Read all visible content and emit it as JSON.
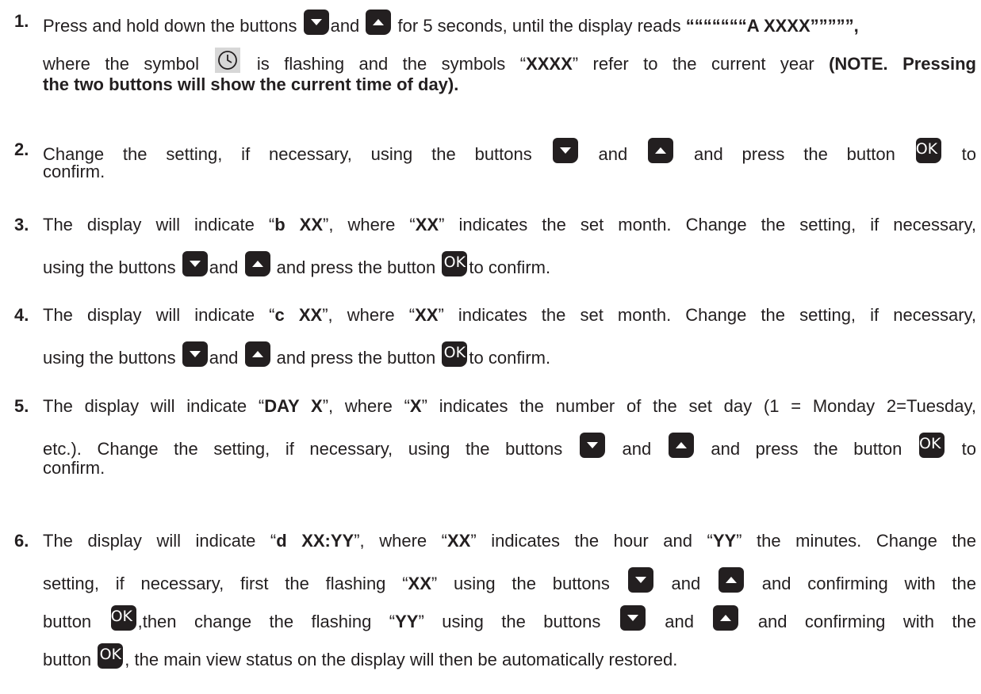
{
  "icons": {
    "down": "down-arrow-button-icon",
    "up": "up-arrow-button-icon",
    "ok": "ok-button-icon",
    "clock": "clock-icon",
    "ok_label": "OK"
  },
  "steps": [
    {
      "num": "1.",
      "l1a": "Press and hold down the buttons",
      "l1b": "and",
      "l1c": "for 5 seconds, until the display reads",
      "l1d": "“““““““A XXXX”””””,",
      "l2a": "where the symbol",
      "l2b": "is flashing and the symbols “",
      "l2c": "XXXX",
      "l2d": "” refer to the current year",
      "l2e": "(NOTE. Pressing",
      "l3": "the two buttons will show the current time of day)."
    },
    {
      "num": "2.",
      "l1a": "Change the setting, if necessary, using the buttons",
      "l1b": "and",
      "l1c": "and press the button",
      "l1d": "to",
      "l2": "confirm."
    },
    {
      "num": "3.",
      "l1a": "The display will indicate “",
      "l1b": "b XX",
      "l1c": "”, where “",
      "l1d": "XX",
      "l1e": "” indicates the set month. Change the setting, if necessary,",
      "l2a": "using the buttons",
      "l2b": "and",
      "l2c": "and press the button",
      "l2d": "to confirm."
    },
    {
      "num": "4.",
      "l1a": "The display will indicate “",
      "l1b": "c XX",
      "l1c": "”, where “",
      "l1d": "XX",
      "l1e": "” indicates the set month.  Change the setting, if necessary,",
      "l2a": "using the buttons",
      "l2b": "and",
      "l2c": "and press the button",
      "l2d": "to confirm."
    },
    {
      "num": "5.",
      "l1a": "The display will indicate “",
      "l1b": "DAY X",
      "l1c": "”, where “",
      "l1d": "X",
      "l1e": "” indicates the number of the set day (1 = Monday 2=Tuesday,",
      "l2a": "etc.). Change the setting, if necessary, using the buttons",
      "l2b": "and",
      "l2c": "and press the button",
      "l2d": "to",
      "l3": "confirm."
    },
    {
      "num": "6.",
      "l1a": "The display will indicate “",
      "l1b": "d XX:YY",
      "l1c": "”, where “",
      "l1d": "XX",
      "l1e": "” indicates the hour and “",
      "l1f": "YY",
      "l1g": "” the minutes. Change the",
      "l2a": "setting, if necessary, first the flashing “",
      "l2b": "XX",
      "l2c": "” using the buttons",
      "l2d": "and",
      "l2e": "and confirming with the",
      "l3a": "button",
      "l3b": ",then change the flashing “",
      "l3c": "YY",
      "l3d": "” using the buttons",
      "l3e": "and",
      "l3f": "and confirming with the",
      "l4a": "button",
      "l4b": ", the main view status on the display will then be automatically restored."
    }
  ]
}
